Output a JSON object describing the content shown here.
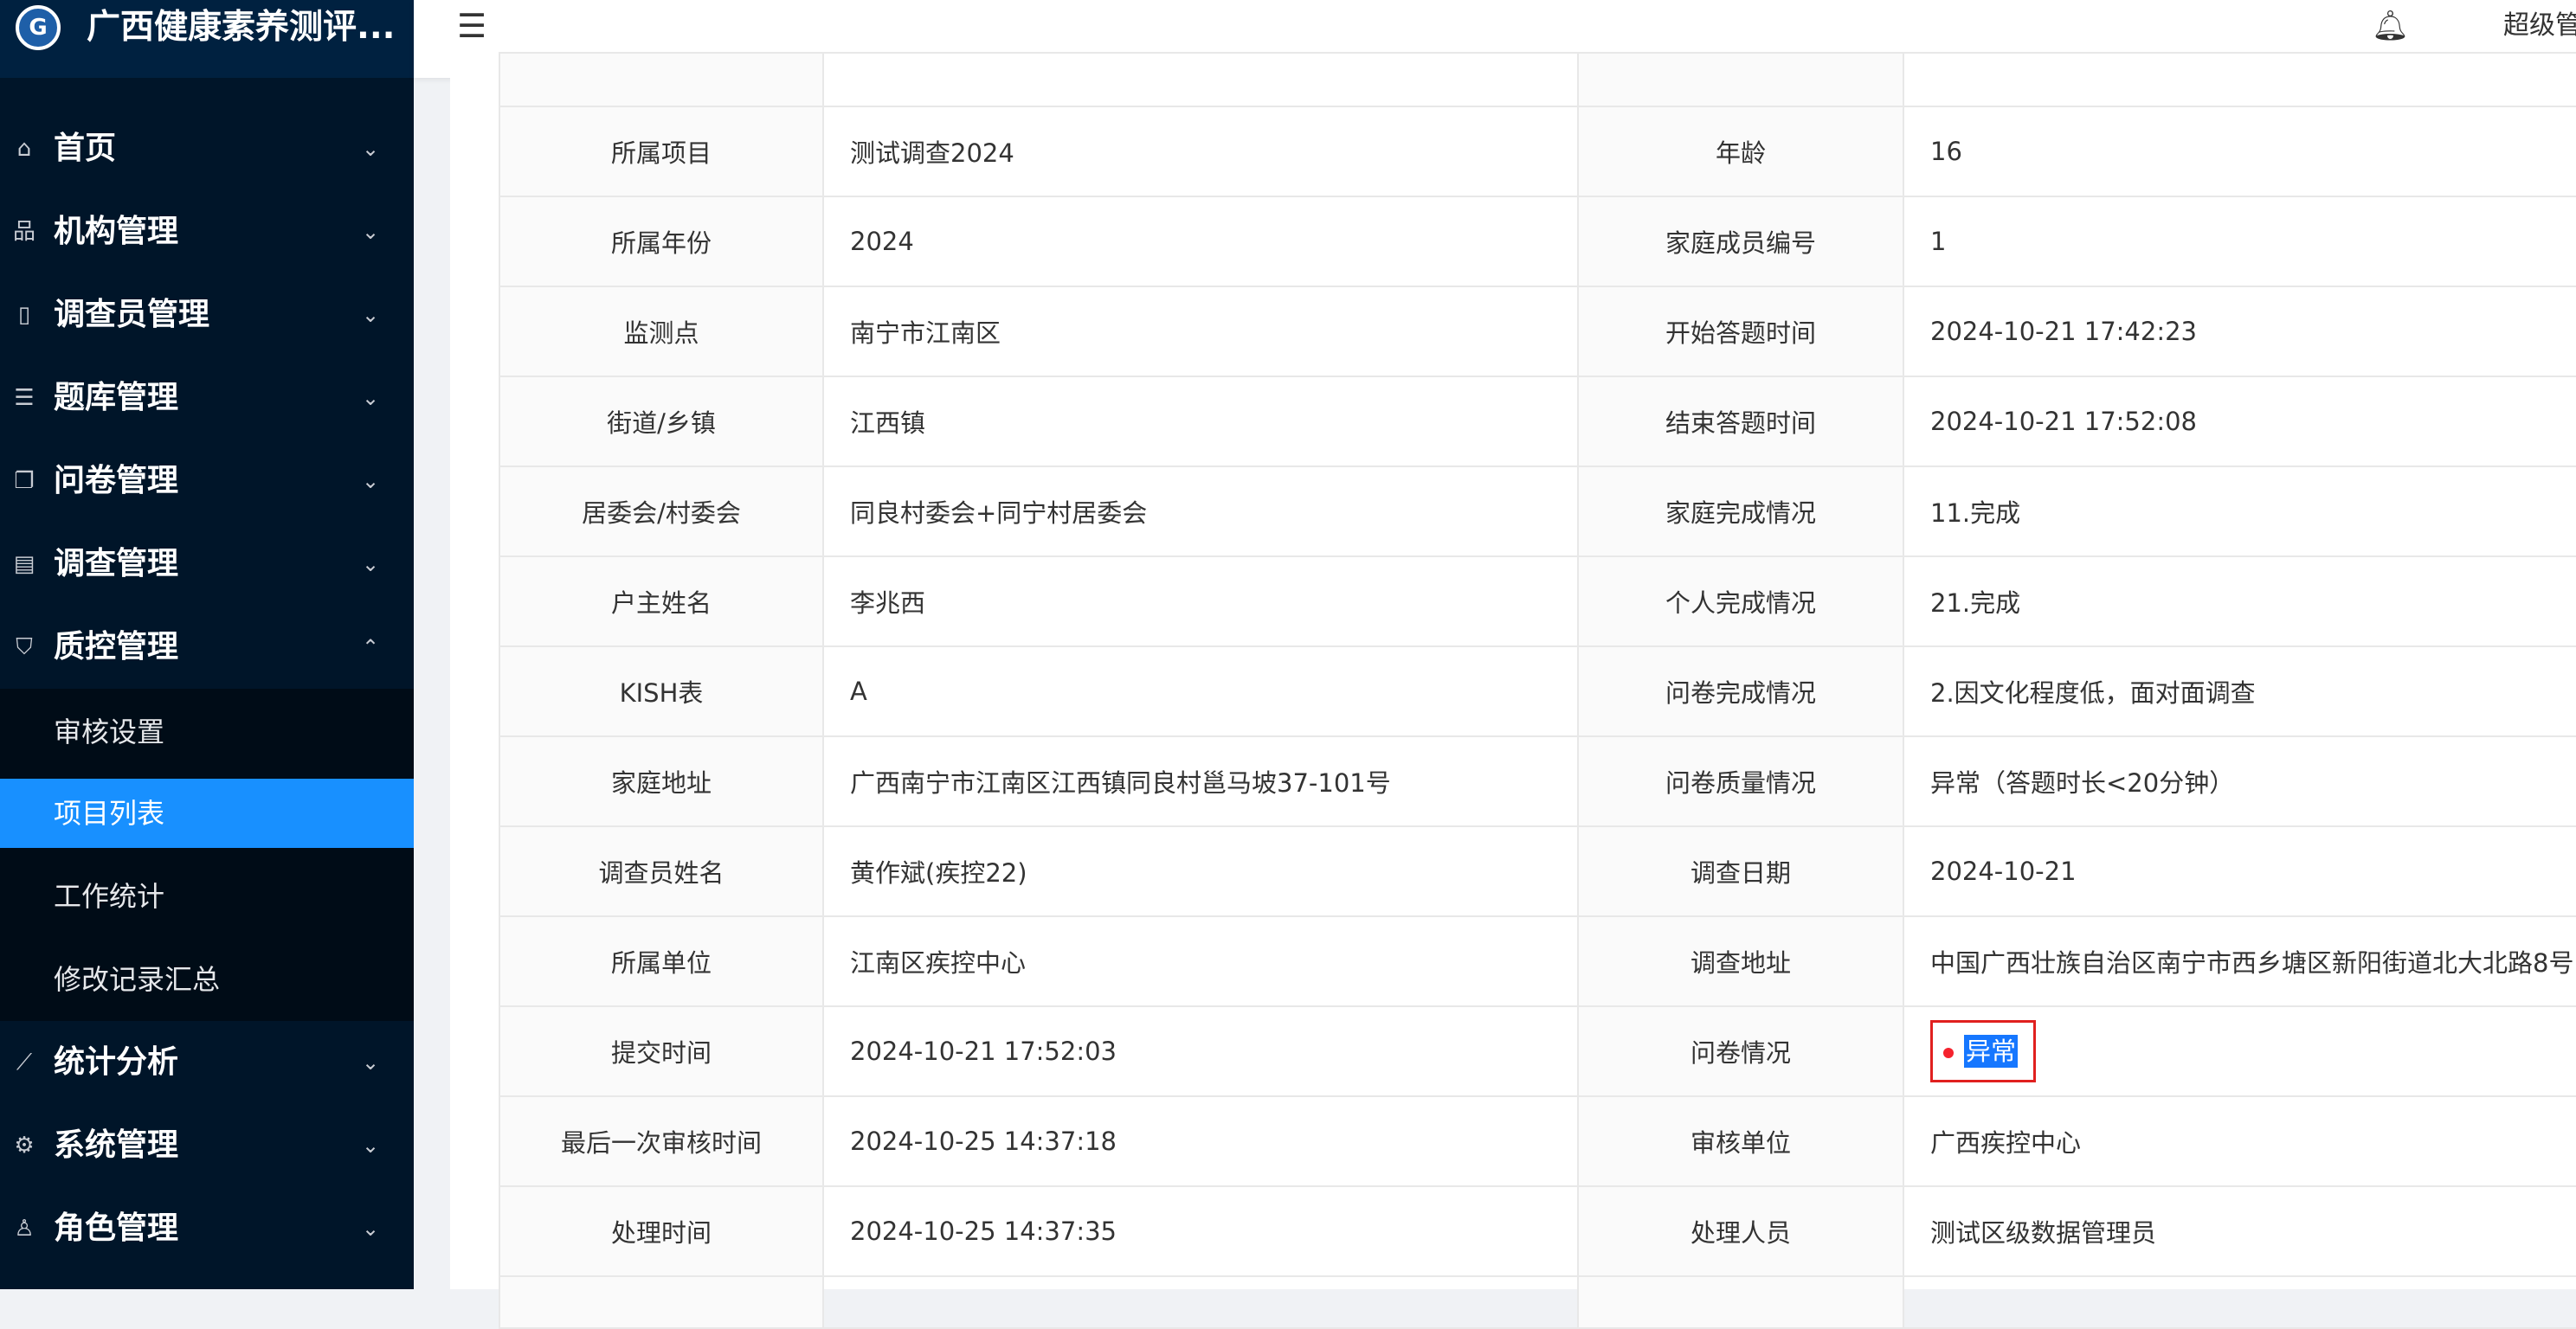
{
  "app": {
    "title": "广西健康素养测评..."
  },
  "sidebar": {
    "menu": [
      {
        "label": "首页",
        "icon": "home-icon"
      },
      {
        "label": "机构管理",
        "icon": "org-icon"
      },
      {
        "label": "调查员管理",
        "icon": "phone-icon"
      },
      {
        "label": "题库管理",
        "icon": "list-icon"
      },
      {
        "label": "问卷管理",
        "icon": "copy-icon"
      },
      {
        "label": "调查管理",
        "icon": "doc-icon"
      },
      {
        "label": "质控管理",
        "icon": "shield-icon",
        "expanded": true
      },
      {
        "label": "统计分析",
        "icon": "chart-icon"
      },
      {
        "label": "系统管理",
        "icon": "gear-icon"
      },
      {
        "label": "角色管理",
        "icon": "user-icon"
      }
    ],
    "submenu": [
      {
        "label": "审核设置"
      },
      {
        "label": "项目列表",
        "active": true
      },
      {
        "label": "工作统计"
      },
      {
        "label": "修改记录汇总"
      }
    ]
  },
  "header": {
    "user": "超级管"
  },
  "detail": {
    "rows": [
      {
        "l1": "",
        "v1": "",
        "l2": "",
        "v2": ""
      },
      {
        "l1": "所属项目",
        "v1": "测试调查2024",
        "l2": "年龄",
        "v2": "16"
      },
      {
        "l1": "所属年份",
        "v1": "2024",
        "l2": "家庭成员编号",
        "v2": "1"
      },
      {
        "l1": "监测点",
        "v1": "南宁市江南区",
        "l2": "开始答题时间",
        "v2": "2024-10-21 17:42:23"
      },
      {
        "l1": "街道/乡镇",
        "v1": "江西镇",
        "l2": "结束答题时间",
        "v2": "2024-10-21 17:52:08"
      },
      {
        "l1": "居委会/村委会",
        "v1": "同良村委会+同宁村居委会",
        "l2": "家庭完成情况",
        "v2": "11.完成"
      },
      {
        "l1": "户主姓名",
        "v1": "李兆西",
        "l2": "个人完成情况",
        "v2": "21.完成"
      },
      {
        "l1": "KISH表",
        "v1": "A",
        "l2": "问卷完成情况",
        "v2": "2.因文化程度低，面对面调查"
      },
      {
        "l1": "家庭地址",
        "v1": "广西南宁市江南区江西镇同良村邕马坡37-101号",
        "l2": "问卷质量情况",
        "v2": "异常（答题时长<20分钟）"
      },
      {
        "l1": "调查员姓名",
        "v1": "黄作斌(疾控22)",
        "l2": "调查日期",
        "v2": "2024-10-21"
      },
      {
        "l1": "所属单位",
        "v1": "江南区疾控中心",
        "l2": "调查地址",
        "v2": "中国广西壮族自治区南宁市西乡塘区新阳街道北大北路8号"
      },
      {
        "l1": "提交时间",
        "v1": "2024-10-21 17:52:03",
        "l2": "问卷情况",
        "v2": "异常"
      },
      {
        "l1": "最后一次审核时间",
        "v1": "2024-10-25 14:37:18",
        "l2": "审核单位",
        "v2": "广西疾控中心"
      },
      {
        "l1": "处理时间",
        "v1": "2024-10-25 14:37:35",
        "l2": "处理人员",
        "v2": "测试区级数据管理员"
      },
      {
        "l1": "",
        "v1": "",
        "l2": "",
        "v2": ""
      }
    ]
  },
  "colors": {
    "sidebar_bg": "#001529",
    "active": "#1890ff",
    "alert": "#f5222d"
  }
}
